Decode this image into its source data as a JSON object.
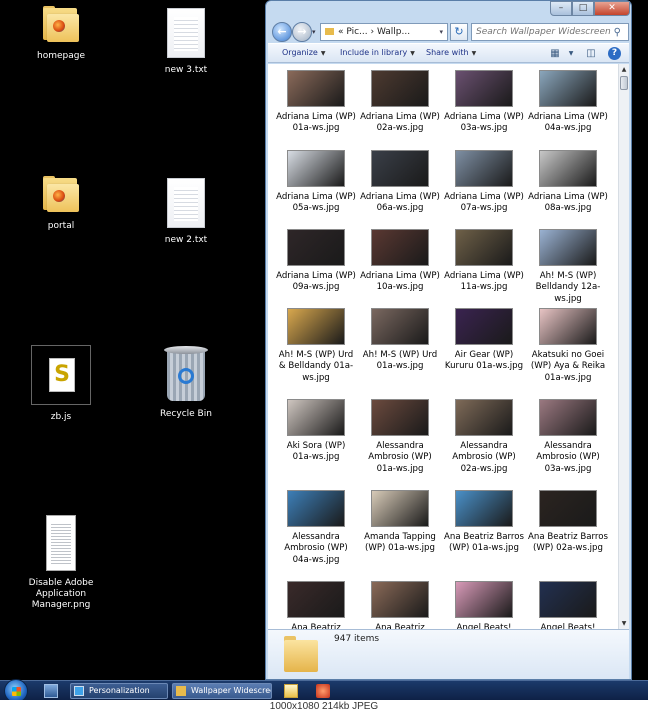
{
  "desktop": {
    "icons": [
      {
        "label": "homepage"
      },
      {
        "label": "new  3.txt"
      },
      {
        "label": "portal"
      },
      {
        "label": "new  2.txt"
      },
      {
        "label": "zb.js"
      },
      {
        "label": "Recycle Bin"
      },
      {
        "label": "Disable Adobe Application Manager.png"
      }
    ]
  },
  "window": {
    "address": "« Pic... › Wallp...",
    "search_placeholder": "Search Wallpaper Widescreen",
    "toolbar": {
      "organize": "Organize",
      "include": "Include in library",
      "share": "Share with"
    },
    "items": [
      {
        "caption": "Adriana Lima (WP) 01a-ws.jpg",
        "color": "#8a6a5a"
      },
      {
        "caption": "Adriana Lima (WP) 02a-ws.jpg",
        "color": "#4d3a30"
      },
      {
        "caption": "Adriana Lima (WP) 03a-ws.jpg",
        "color": "#6a5070"
      },
      {
        "caption": "Adriana Lima (WP) 04a-ws.jpg",
        "color": "#8aa6bc"
      },
      {
        "caption": "Adriana Lima (WP) 05a-ws.jpg",
        "color": "#d8dde4"
      },
      {
        "caption": "Adriana Lima (WP) 06a-ws.jpg",
        "color": "#3a3f48"
      },
      {
        "caption": "Adriana Lima (WP) 07a-ws.jpg",
        "color": "#7e8fa3"
      },
      {
        "caption": "Adriana Lima (WP) 08a-ws.jpg",
        "color": "#c8c8c8"
      },
      {
        "caption": "Adriana Lima (WP) 09a-ws.jpg",
        "color": "#2e2628"
      },
      {
        "caption": "Adriana Lima (WP) 10a-ws.jpg",
        "color": "#5a3832"
      },
      {
        "caption": "Adriana Lima (WP) 11a-ws.jpg",
        "color": "#6e6048"
      },
      {
        "caption": "Ah! M-S (WP) Belldandy 12a-ws.jpg",
        "color": "#9ab2d2"
      },
      {
        "caption": "Ah! M-S (WP) Urd & Belldandy 01a-ws.jpg",
        "color": "#d9a84e"
      },
      {
        "caption": "Ah! M-S (WP) Urd 01a-ws.jpg",
        "color": "#7a6860"
      },
      {
        "caption": "Air Gear (WP) Kururu 01a-ws.jpg",
        "color": "#3a2350"
      },
      {
        "caption": "Akatsuki no Goei (WP) Aya & Reika 01a-ws.jpg",
        "color": "#e8c4c4"
      },
      {
        "caption": "Aki Sora (WP) 01a-ws.jpg",
        "color": "#cfc6c0"
      },
      {
        "caption": "Alessandra Ambrosio (WP) 01a-ws.jpg",
        "color": "#6b4a3e"
      },
      {
        "caption": "Alessandra Ambrosio (WP) 02a-ws.jpg",
        "color": "#7e6a58"
      },
      {
        "caption": "Alessandra Ambrosio (WP) 03a-ws.jpg",
        "color": "#9a7880"
      },
      {
        "caption": "Alessandra Ambrosio (WP) 04a-ws.jpg",
        "color": "#3d7fb8"
      },
      {
        "caption": "Amanda Tapping (WP) 01a-ws.jpg",
        "color": "#d8cbb8"
      },
      {
        "caption": "Ana Beatriz Barros (WP) 01a-ws.jpg",
        "color": "#4a90c8"
      },
      {
        "caption": "Ana Beatriz Barros (WP) 02a-ws.jpg",
        "color": "#2b2420"
      },
      {
        "caption": "Ana Beatriz",
        "color": "#3a2a2a"
      },
      {
        "caption": "Ana Beatriz",
        "color": "#8a6a58"
      },
      {
        "caption": "Angel Beats!",
        "color": "#d89ab8"
      },
      {
        "caption": "Angel Beats!",
        "color": "#223050"
      }
    ],
    "status": "947 items"
  },
  "taskbar": {
    "task1": "Personalization",
    "task2": "Wallpaper Widescreen"
  },
  "footer": "1000x1080  214kb  JPEG"
}
